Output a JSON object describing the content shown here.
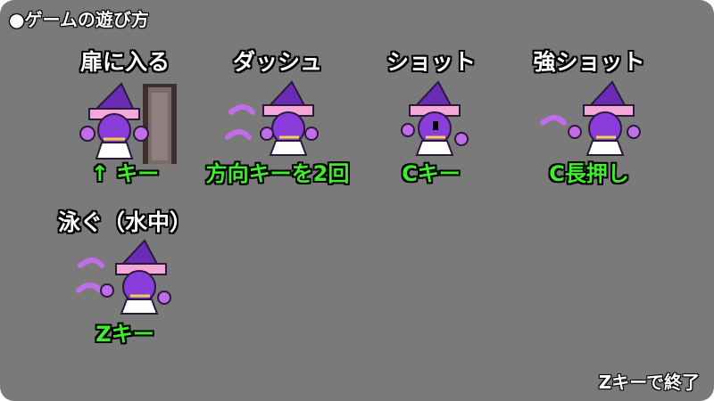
{
  "screen": {
    "title": "●ゲームの遊び方",
    "exit_hint": "Zキーで終了"
  },
  "actions": [
    {
      "title": "扉に入る",
      "key": "↑ キー",
      "sprite": "witch-enter-door"
    },
    {
      "title": "ダッシュ",
      "key": "方向キーを2回",
      "sprite": "witch-dash"
    },
    {
      "title": "ショット",
      "key": "Cキー",
      "sprite": "witch-shot"
    },
    {
      "title": "強ショット",
      "key": "C長押し",
      "sprite": "witch-strong-shot"
    },
    {
      "title": "泳ぐ（水中）",
      "key": "Zキー",
      "sprite": "witch-swim"
    }
  ],
  "colors": {
    "background": "#7a7a7a",
    "key_text": "#3ef02a",
    "title_text": "#ffffff",
    "witch_purple": "#6a2bb5",
    "witch_hat_band": "#f5a8d8"
  }
}
